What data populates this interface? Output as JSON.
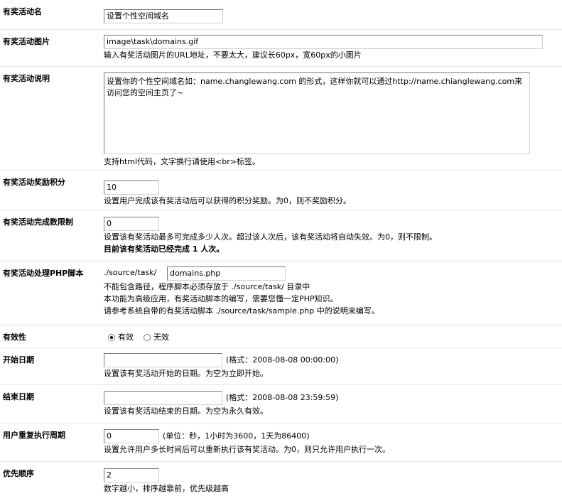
{
  "fields": [
    {
      "label": "有奖活动名",
      "value": "设置个性空间域名"
    },
    {
      "label": "有奖活动图片",
      "value": "image\\task\\domains.gif",
      "note": "输入有奖活动图片的URL地址，不要太大，建议长60px，宽60px的小图片"
    },
    {
      "label": "有奖活动说明",
      "value": "设置你的个性空间域名如：name.changlewang.com 的形式，这样你就可以通过http://name.chianglewang.com来访问您的空间主页了~",
      "note": "支持html代码，文字换行请使用<br>标签。"
    },
    {
      "label": "有奖活动奖励积分",
      "value": "10",
      "note": "设置用户完成该有奖活动后可以获得的积分奖励。为0，则不奖励积分。"
    },
    {
      "label": "有奖活动完成数限制",
      "value": "0",
      "note": "设置该有奖活动最多可完成多少人次。超过该人次后，该有奖活动将自动失效。为0，则不限制。",
      "status": "目前该有奖活动已经完成  1 人次。"
    },
    {
      "label": "有奖活动处理PHP脚本",
      "prefix": "./source/task/",
      "value": "domains.php",
      "note1": "不能包含路径，程序脚本必须存放于 ./source/task/ 目录中",
      "note2": "本功能为高级应用，有奖活动脚本的编写，需要您懂一定PHP知识。",
      "note3": "请参考系统自带的有奖活动脚本 ./source/task/sample.php 中的说明来编写。"
    },
    {
      "label": "有效性",
      "option_yes": "有效",
      "option_no": "无效"
    },
    {
      "label": "开始日期",
      "value": "",
      "suffix": "(格式：2008-08-08 00:00:00)",
      "note": "设置该有奖活动开始的日期。为空为立即开始。"
    },
    {
      "label": "结束日期",
      "value": "",
      "suffix": "(格式：2008-08-08 23:59:59)",
      "note": "设置该有奖活动结束的日期。为空为永久有效。"
    },
    {
      "label": "用户重复执行周期",
      "value": "0",
      "suffix": "(单位：秒，1小时为3600，1天为86400)",
      "note": "设置允许用户多长时间后可以重新执行该有奖活动。为0，则只允许用户执行一次。"
    },
    {
      "label": "优先顺序",
      "value": "2",
      "note": "数字越小，排序越靠前，优先级越高"
    }
  ]
}
